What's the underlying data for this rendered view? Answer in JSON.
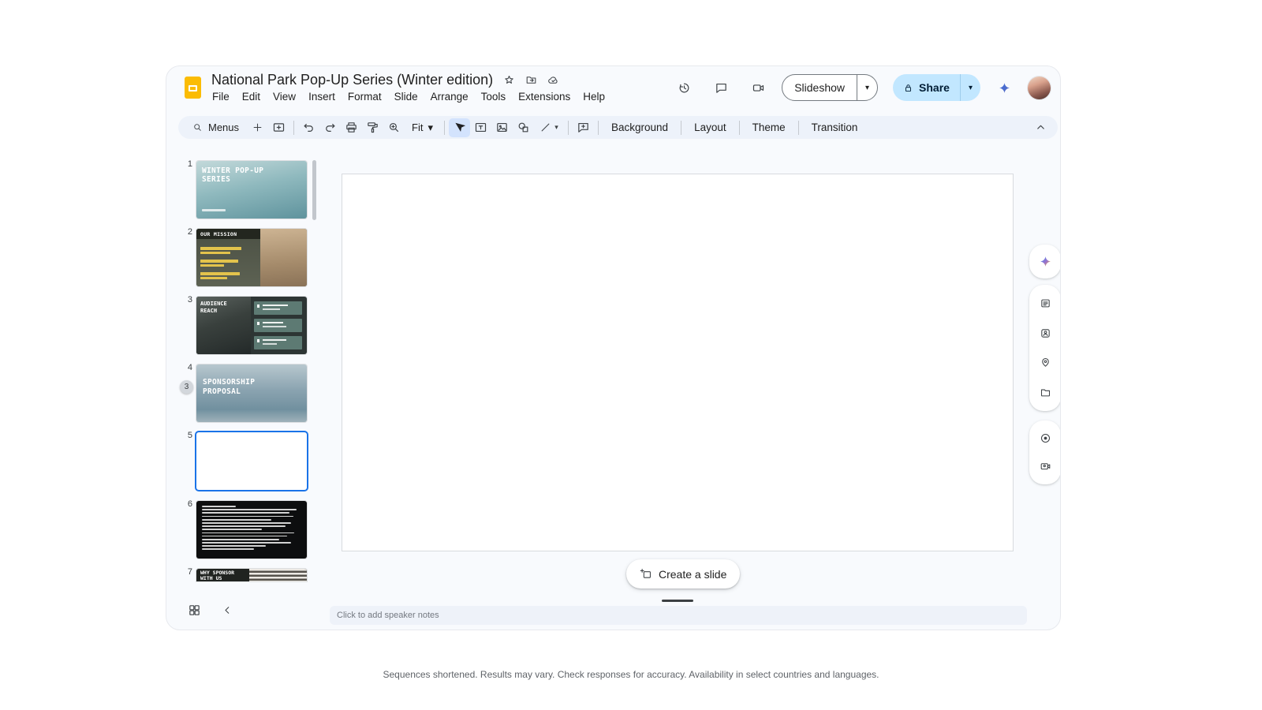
{
  "app": {
    "title": "National Park Pop-Up Series (Winter edition)",
    "menu_items": [
      "File",
      "Edit",
      "View",
      "Insert",
      "Format",
      "Slide",
      "Arrange",
      "Tools",
      "Extensions",
      "Help"
    ]
  },
  "header": {
    "slideshow_label": "Slideshow",
    "share_label": "Share"
  },
  "toolbar": {
    "menus_label": "Menus",
    "zoom_value": "Fit",
    "background_label": "Background",
    "layout_label": "Layout",
    "theme_label": "Theme",
    "transition_label": "Transition"
  },
  "filmstrip": {
    "drag_badge": "3",
    "slides": [
      {
        "number": "1",
        "title": "WINTER POP-UP SERIES"
      },
      {
        "number": "2",
        "title": "OUR MISSION"
      },
      {
        "number": "3",
        "title": "AUDIENCE REACH"
      },
      {
        "number": "4",
        "title": "SPONSORSHIP PROPOSAL"
      },
      {
        "number": "5",
        "title": ""
      },
      {
        "number": "6",
        "title": ""
      },
      {
        "number": "7",
        "title": "WHY SPONSOR WITH US"
      }
    ]
  },
  "canvas": {
    "create_slide_label": "Create a slide",
    "notes_placeholder": "Click to add speaker notes"
  },
  "footer": {
    "disclaimer": "Sequences shortened. Results may vary. Check responses for accuracy. Availability in select countries and languages."
  },
  "icons": {
    "dropdown_arrow": "▾"
  },
  "colors": {
    "accent_blue": "#1a73e8",
    "toolbar_bg": "#edf2fa",
    "selected_tool_bg": "#d3e3fd",
    "share_bg": "#c2e7ff",
    "slides_yellow": "#fbbc04"
  }
}
